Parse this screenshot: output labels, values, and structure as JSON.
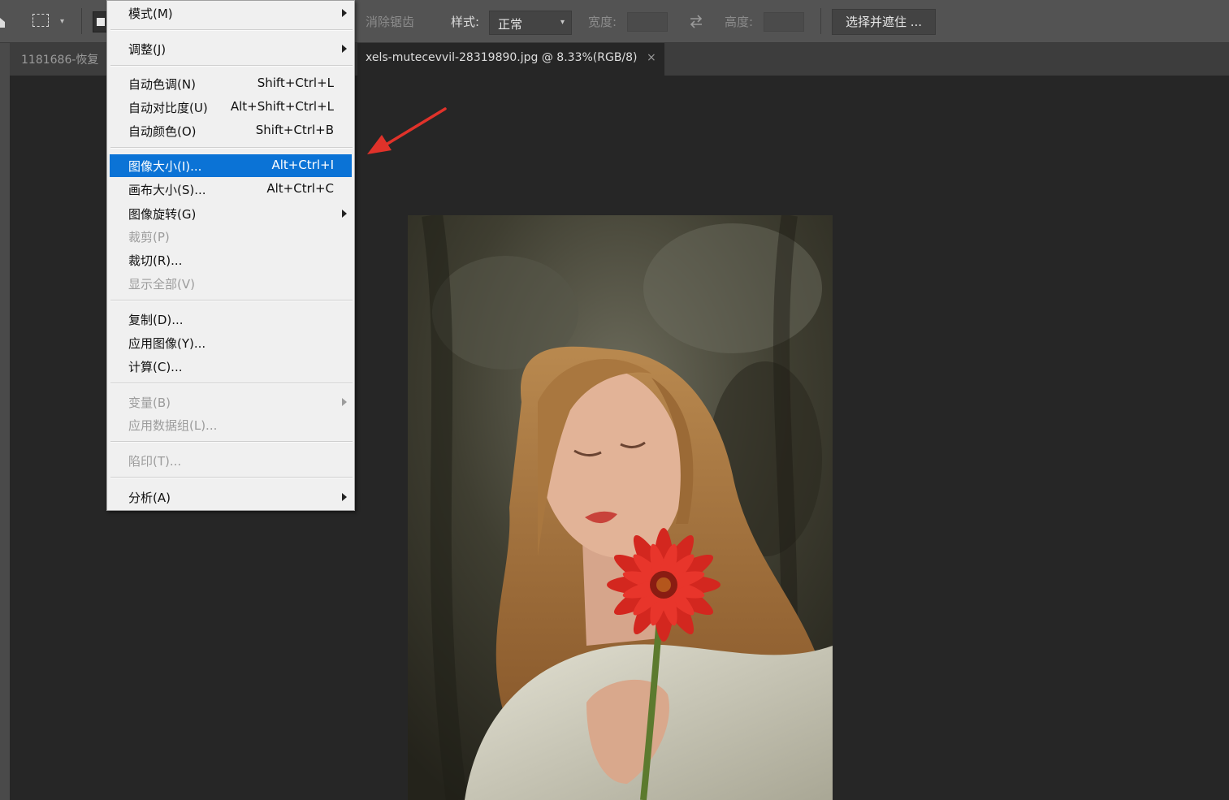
{
  "options_bar": {
    "feather_label": "消除锯齿",
    "style_label": "样式:",
    "style_value": "正常",
    "width_label": "宽度:",
    "height_label": "高度:",
    "select_mask_label": "选择并遮住 ..."
  },
  "tabs": [
    {
      "label": "1181686-恢复"
    },
    {
      "label": "xels-mutecevvil-28319890.jpg @ 8.33%(RGB/8)",
      "close": "×"
    }
  ],
  "menu": {
    "items": [
      {
        "label": "模式(M)",
        "shortcut": "",
        "submenu": true,
        "disabled": false
      },
      {
        "label": "调整(J)",
        "shortcut": "",
        "submenu": true,
        "disabled": false
      },
      {
        "label": "自动色调(N)",
        "shortcut": "Shift+Ctrl+L",
        "submenu": false,
        "disabled": false
      },
      {
        "label": "自动对比度(U)",
        "shortcut": "Alt+Shift+Ctrl+L",
        "submenu": false,
        "disabled": false
      },
      {
        "label": "自动颜色(O)",
        "shortcut": "Shift+Ctrl+B",
        "submenu": false,
        "disabled": false
      },
      {
        "label": "图像大小(I)...",
        "shortcut": "Alt+Ctrl+I",
        "submenu": false,
        "disabled": false,
        "highlighted": true
      },
      {
        "label": "画布大小(S)...",
        "shortcut": "Alt+Ctrl+C",
        "submenu": false,
        "disabled": false
      },
      {
        "label": "图像旋转(G)",
        "shortcut": "",
        "submenu": true,
        "disabled": false
      },
      {
        "label": "裁剪(P)",
        "shortcut": "",
        "submenu": false,
        "disabled": true
      },
      {
        "label": "裁切(R)...",
        "shortcut": "",
        "submenu": false,
        "disabled": false
      },
      {
        "label": "显示全部(V)",
        "shortcut": "",
        "submenu": false,
        "disabled": true
      },
      {
        "label": "复制(D)...",
        "shortcut": "",
        "submenu": false,
        "disabled": false
      },
      {
        "label": "应用图像(Y)...",
        "shortcut": "",
        "submenu": false,
        "disabled": false
      },
      {
        "label": "计算(C)...",
        "shortcut": "",
        "submenu": false,
        "disabled": false
      },
      {
        "label": "变量(B)",
        "shortcut": "",
        "submenu": true,
        "disabled": true
      },
      {
        "label": "应用数据组(L)...",
        "shortcut": "",
        "submenu": false,
        "disabled": true
      },
      {
        "label": "陷印(T)...",
        "shortcut": "",
        "submenu": false,
        "disabled": true
      },
      {
        "label": "分析(A)",
        "shortcut": "",
        "submenu": true,
        "disabled": false
      }
    ]
  },
  "colors": {
    "highlight": "#0b73d6",
    "annotation_arrow": "#e0322a",
    "workspace": "#262626"
  }
}
